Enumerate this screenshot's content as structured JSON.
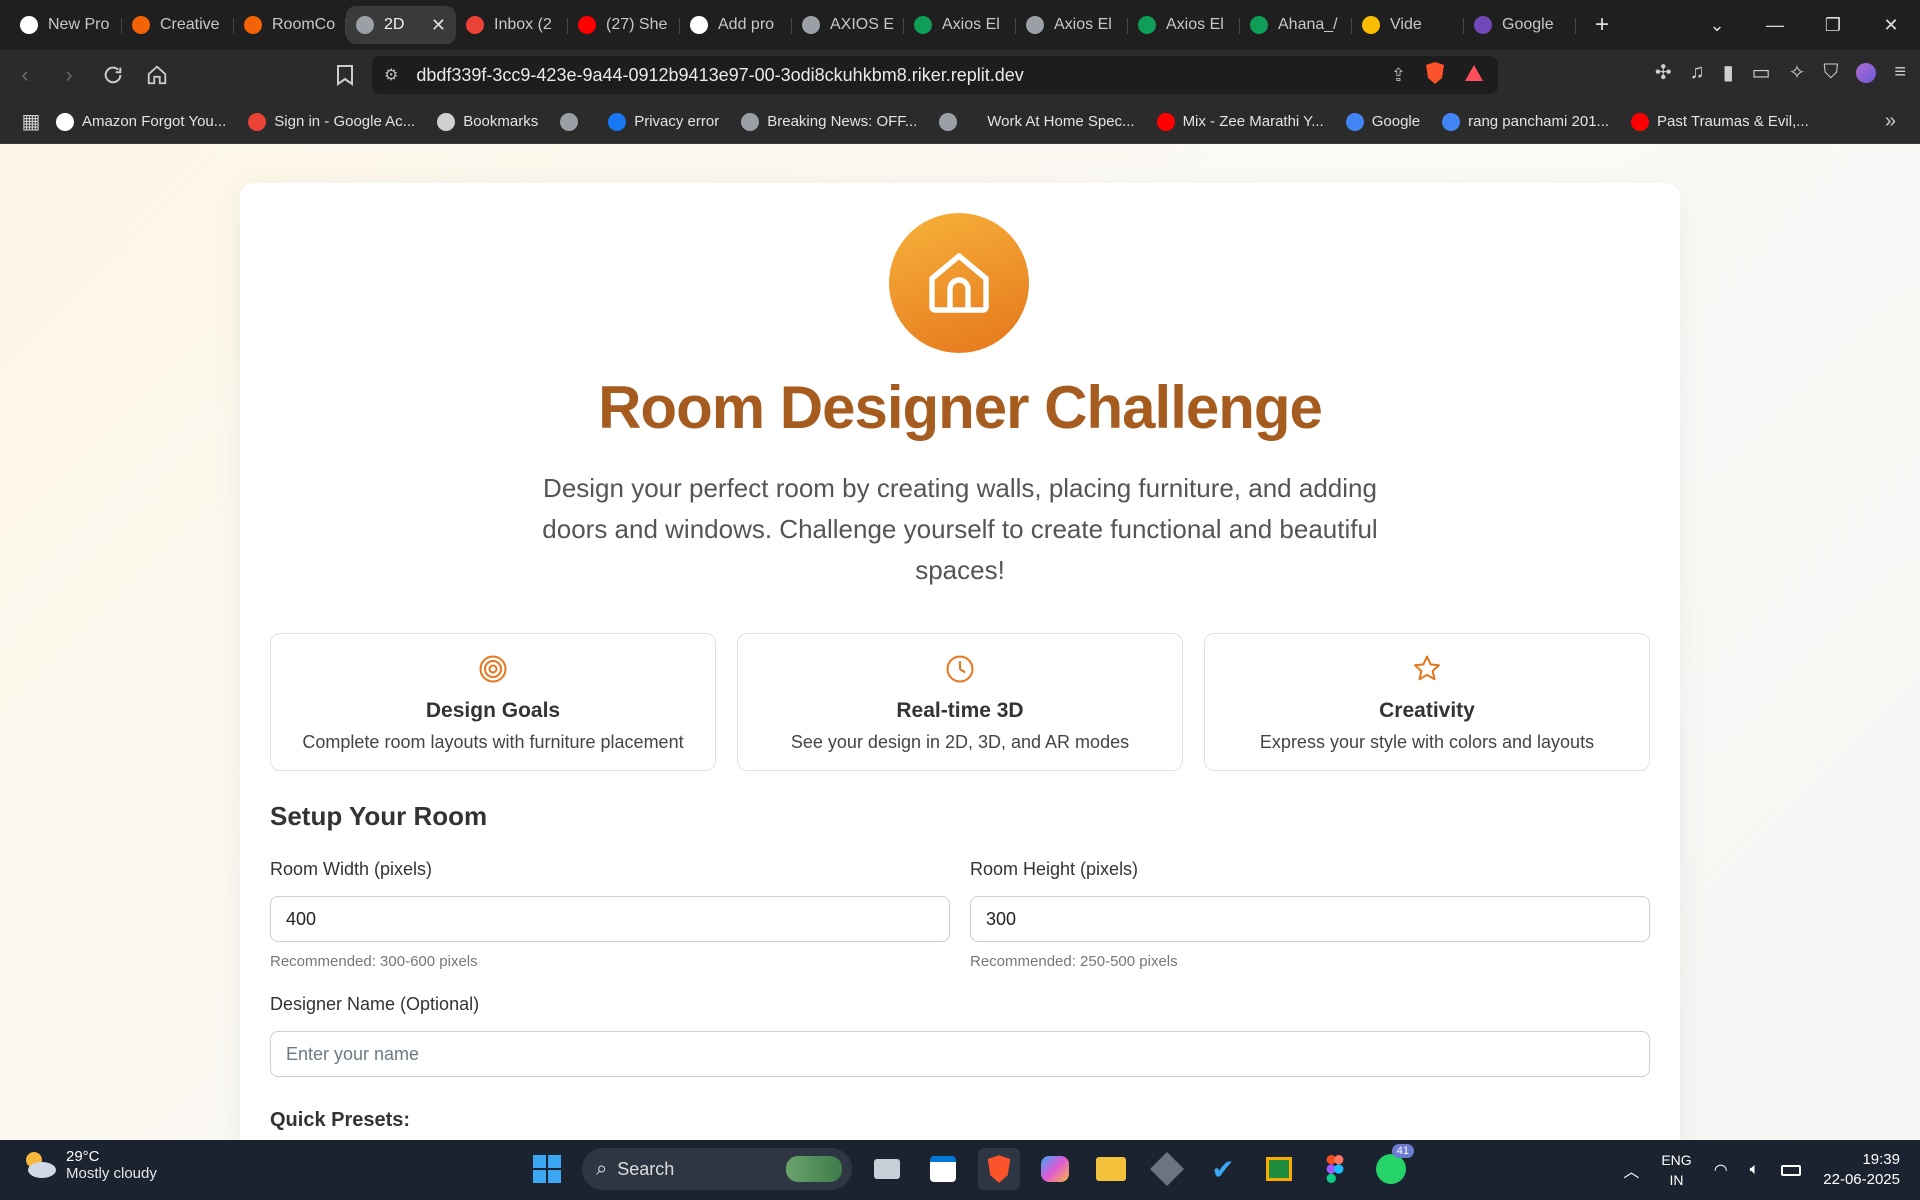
{
  "browser": {
    "tabs": [
      {
        "label": "New Pro",
        "icon": "brand-a-icon",
        "color": "#ffffff"
      },
      {
        "label": "Creative",
        "icon": "replit-icon",
        "color": "#f26207"
      },
      {
        "label": "RoomCo",
        "icon": "replit-icon",
        "color": "#f26207"
      },
      {
        "label": "2D",
        "icon": "globe-icon",
        "color": "#9aa0a6",
        "active": true
      },
      {
        "label": "Inbox (2",
        "icon": "gmail-icon",
        "color": "#ea4335"
      },
      {
        "label": "(27) She",
        "icon": "youtube-icon",
        "color": "#ff0000"
      },
      {
        "label": "Add pro",
        "icon": "openai-icon",
        "color": "#ffffff"
      },
      {
        "label": "AXIOS E",
        "icon": "globe-icon",
        "color": "#9aa0a6"
      },
      {
        "label": "Axios El",
        "icon": "sheets-icon",
        "color": "#0f9d58"
      },
      {
        "label": "Axios El",
        "icon": "globe-icon",
        "color": "#9aa0a6"
      },
      {
        "label": "Axios El",
        "icon": "sheets-icon",
        "color": "#0f9d58"
      },
      {
        "label": "Ahana_/",
        "icon": "sheets-icon",
        "color": "#0f9d58"
      },
      {
        "label": "Vide",
        "icon": "photos-icon",
        "color": "#fbbc04"
      },
      {
        "label": "Google",
        "icon": "forms-icon",
        "color": "#7248b9"
      }
    ],
    "url": "dbdf339f-3cc9-423e-9a44-0912b9413e97-00-3odi8ckuhkbm8.riker.replit.dev",
    "bookmarks": [
      {
        "label": "Amazon Forgot You...",
        "icon": "amazon-icon",
        "color": "#ffffff"
      },
      {
        "label": "Sign in - Google Ac...",
        "icon": "gmail-icon",
        "color": "#ea4335"
      },
      {
        "label": "Bookmarks",
        "icon": "bookmarks-folder-icon",
        "color": "#cfcfcf"
      },
      {
        "label": "",
        "icon": "globe-icon",
        "color": "#9aa0a6"
      },
      {
        "label": "Privacy error",
        "icon": "facebook-icon",
        "color": "#1877f2"
      },
      {
        "label": "Breaking News: OFF...",
        "icon": "globe-icon",
        "color": "#9aa0a6"
      },
      {
        "label": "",
        "icon": "globe-icon",
        "color": "#9aa0a6"
      },
      {
        "label": "Work At Home Spec...",
        "icon": "",
        "color": ""
      },
      {
        "label": "Mix - Zee Marathi Y...",
        "icon": "youtube-icon",
        "color": "#ff0000"
      },
      {
        "label": "Google",
        "icon": "google-icon",
        "color": "#4285f4"
      },
      {
        "label": "rang panchami 201...",
        "icon": "google-icon",
        "color": "#4285f4"
      },
      {
        "label": "Past Traumas & Evil,...",
        "icon": "youtube-icon",
        "color": "#ff0000"
      }
    ]
  },
  "page": {
    "title": "Room Designer Challenge",
    "subtitle": "Design your perfect room by creating walls, placing furniture, and adding doors and windows. Challenge yourself to create functional and beautiful spaces!",
    "features": [
      {
        "name": "Design Goals",
        "desc": "Complete room layouts with furniture placement",
        "icon": "target-icon"
      },
      {
        "name": "Real-time 3D",
        "desc": "See your design in 2D, 3D, and AR modes",
        "icon": "clock-icon"
      },
      {
        "name": "Creativity",
        "desc": "Express your style with colors and layouts",
        "icon": "star-icon"
      }
    ],
    "setup": {
      "title": "Setup Your Room",
      "width_label": "Room Width (pixels)",
      "width_value": "400",
      "width_hint": "Recommended: 300-600 pixels",
      "height_label": "Room Height (pixels)",
      "height_value": "300",
      "height_hint": "Recommended: 250-500 pixels",
      "name_label": "Designer Name (Optional)",
      "name_placeholder": "Enter your name",
      "presets_label": "Quick Presets:"
    },
    "accent": "#e88a25",
    "title_color": "#a55c1e"
  },
  "taskbar": {
    "weather_temp": "29°C",
    "weather_cond": "Mostly cloudy",
    "search": "Search",
    "lang1": "ENG",
    "lang2": "IN",
    "time": "19:39",
    "date": "22-06-2025",
    "whatsapp_badge": "41"
  }
}
